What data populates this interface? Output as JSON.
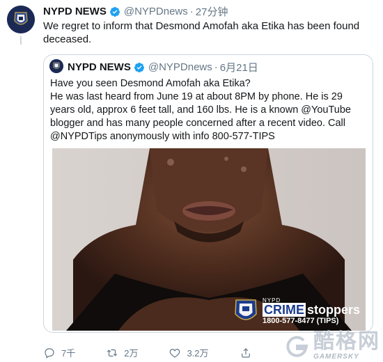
{
  "tweet": {
    "name": "NYPD NEWS",
    "handle": "@NYPDnews",
    "separator": "·",
    "time": "27分钟",
    "text": "We regret to inform that Desmond Amofah aka Etika has been found deceased."
  },
  "quoted": {
    "name": "NYPD NEWS",
    "handle": "@NYPDnews",
    "separator": "·",
    "time": "6月21日",
    "lines": [
      "Have you seen Desmond Amofah aka Etika?",
      "He was last heard from June 19 at about 8PM by phone. He is 29 years old, approx 6 feet tall, and 160 lbs. He is a known @YouTube blogger and has many people concerned after a recent video. Call @NYPDTips anonymously with info 800-577-TIPS"
    ],
    "badge": {
      "nypd": "NYPD",
      "crime": "CRIME",
      "stoppers": "stoppers",
      "phone": "1800-577-8477 (TIPS)"
    }
  },
  "actions": {
    "reply_count": "7千",
    "retweet_count": "2万",
    "like_count": "3.2万"
  },
  "watermark": {
    "cn": "酷格网",
    "en": "GAMERSKY"
  },
  "colors": {
    "verified": "#1da1f2",
    "muted": "#657786",
    "border": "#ccd6dd"
  }
}
